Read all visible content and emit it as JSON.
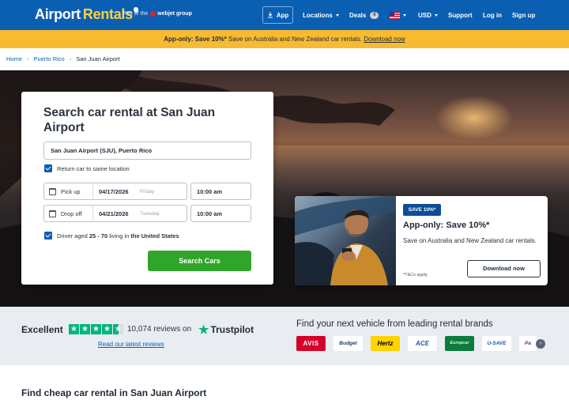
{
  "header": {
    "logo_word1": "Airport",
    "logo_word2": "Rentals",
    "part_of": "Part of the",
    "group_name": "webjet group",
    "app_button": "App",
    "nav": {
      "locations": "Locations",
      "deals": "Deals",
      "deals_count": "6",
      "currency": "USD",
      "support": "Support",
      "login": "Log in",
      "signup": "Sign up"
    }
  },
  "promo_banner": {
    "bold": "App-only: Save 10%*",
    "text": " Save on Australia and New Zealand car rentals. ",
    "link": "Download now"
  },
  "breadcrumb": [
    "Home",
    "Puerto Rico",
    "San Juan Airport"
  ],
  "search": {
    "title": "Search car rental at San Juan Airport",
    "location_value": "San Juan Airport (SJU), Puerto Rico",
    "return_same_label": "Return car to same location",
    "pickup": {
      "label": "Pick up",
      "date": "04/17/2026",
      "day": "Friday",
      "time": "10:00 am"
    },
    "dropoff": {
      "label": "Drop off",
      "date": "04/21/2026",
      "day": "Tuesday",
      "time": "10:00 am"
    },
    "driver_prefix": "Driver aged ",
    "driver_age": "25 - 70",
    "driver_mid": " living in ",
    "driver_country": "the United States",
    "button": "Search Cars"
  },
  "app_promo": {
    "badge": "SAVE 10%*",
    "title": "App-only: Save 10%*",
    "text": "Save on Australia and New Zealand car rentals.",
    "tc": "*T&Cs apply.",
    "button": "Download now"
  },
  "reviews": {
    "rating_word": "Excellent",
    "count_text": "10,074 reviews on",
    "brand": "Trustpilot",
    "link": "Read our latest reviews",
    "stars": 4.5
  },
  "brands": {
    "title": "Find your next vehicle from leading rental brands",
    "items": [
      "AVIS",
      "Budget",
      "Hertz",
      "ACE",
      "Europcar",
      "U-SAVE",
      "Pa"
    ]
  },
  "section_title": "Find cheap car rental in San Juan Airport",
  "colors": {
    "header_blue": "#0b5fb3",
    "banner_yellow": "#f7ba31",
    "search_green": "#2fa52a",
    "trustpilot_green": "#00b67a"
  }
}
